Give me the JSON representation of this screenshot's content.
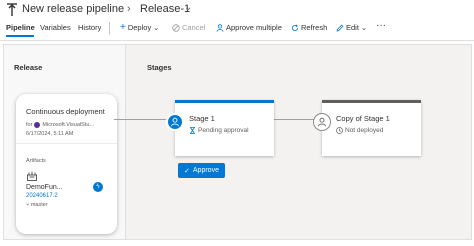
{
  "header": {
    "pipeline_title": "New release pipeline",
    "separator": "›",
    "release_name": "Release-1",
    "release_chevron": "⌄"
  },
  "tabs": [
    {
      "label": "Pipeline",
      "active": true
    },
    {
      "label": "Variables",
      "active": false
    },
    {
      "label": "History",
      "active": false
    }
  ],
  "toolbar": {
    "deploy_label": "Deploy",
    "cancel_label": "Cancel",
    "approve_multiple_label": "Approve multiple",
    "refresh_label": "Refresh",
    "edit_label": "Edit",
    "more_label": "···"
  },
  "release_section": {
    "heading": "Release",
    "card": {
      "title": "Continuous deployment",
      "for_prefix": "for",
      "requested_by": "Microsoft.VisualStu...",
      "date": "6/17/2024, 5:11 AM",
      "artifacts_label": "Artifacts",
      "artifact_name": "DemoFun...",
      "artifact_version": "20240617.2",
      "artifact_branch": "master"
    }
  },
  "stages_section": {
    "heading": "Stages",
    "stages": [
      {
        "name": "Stage 1",
        "status": "Pending approval",
        "status_icon": "hourglass-icon"
      },
      {
        "name": "Copy of Stage 1",
        "status": "Not deployed",
        "status_icon": "clock-icon"
      }
    ],
    "approve_button_label": "Approve"
  },
  "colors": {
    "accent": "#0078d4",
    "canvas_bg": "#f3f2f1",
    "stage2_top": "#605e5c"
  }
}
